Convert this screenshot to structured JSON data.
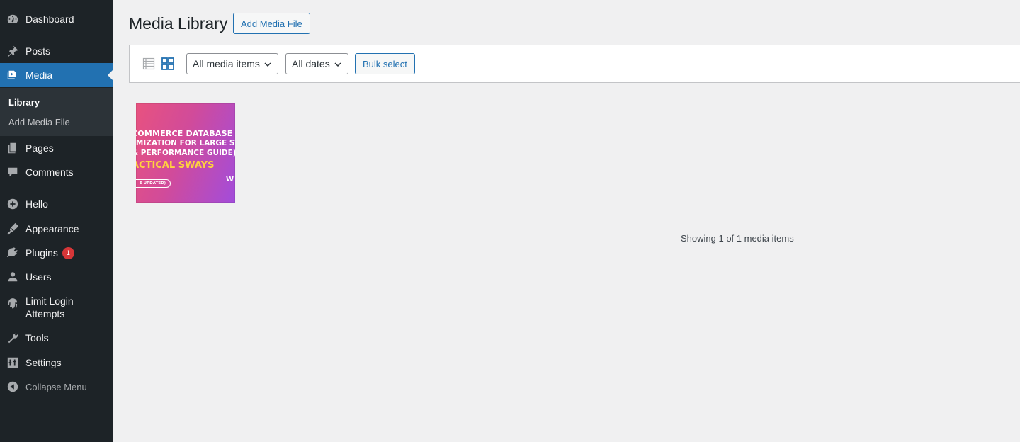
{
  "sidebar": {
    "items": [
      {
        "key": "dashboard",
        "label": "Dashboard",
        "icon": "dashboard-icon"
      },
      {
        "key": "posts",
        "label": "Posts",
        "icon": "pin-icon"
      },
      {
        "key": "media",
        "label": "Media",
        "icon": "media-icon",
        "current": true
      },
      {
        "key": "pages",
        "label": "Pages",
        "icon": "pages-icon"
      },
      {
        "key": "comments",
        "label": "Comments",
        "icon": "comment-icon"
      },
      {
        "key": "hello",
        "label": "Hello",
        "icon": "plus-circle-icon"
      },
      {
        "key": "appearance",
        "label": "Appearance",
        "icon": "brush-icon"
      },
      {
        "key": "plugins",
        "label": "Plugins",
        "icon": "plug-icon",
        "badge": "1"
      },
      {
        "key": "users",
        "label": "Users",
        "icon": "user-icon"
      },
      {
        "key": "limit-login",
        "label_line1": "Limit Login",
        "label_line2": "Attempts",
        "icon": "fingerprint-icon"
      },
      {
        "key": "tools",
        "label": "Tools",
        "icon": "wrench-icon"
      },
      {
        "key": "settings",
        "label": "Settings",
        "icon": "sliders-icon"
      },
      {
        "key": "collapse",
        "label": "Collapse Menu",
        "icon": "collapse-arrow-icon"
      }
    ],
    "media_submenu": {
      "library": "Library",
      "add_new": "Add Media File"
    }
  },
  "header": {
    "title": "Media Library",
    "add_button": "Add Media File"
  },
  "toolbar": {
    "list_view_icon": "list-view-icon",
    "grid_view_icon": "grid-view-icon",
    "grid_view_active": true,
    "filter_type": {
      "selected": "All media items"
    },
    "filter_date": {
      "selected": "All dates"
    },
    "bulk_select_label": "Bulk select"
  },
  "media_items": [
    {
      "thumbnail_lines": [
        "COMMERCE DATABASE",
        "IMIZATION FOR LARGE STORES",
        "& PERFORMANCE GUIDE)",
        "ACTICAL SWAYS"
      ],
      "thumbnail_pill": "E UPDATED)",
      "thumbnail_mark": "W"
    }
  ],
  "status": {
    "text": "Showing 1 of 1 media items"
  },
  "colors": {
    "sidebar_bg": "#1d2327",
    "accent": "#2271b1",
    "badge": "#d63638",
    "page_bg": "#f0f0f1"
  }
}
